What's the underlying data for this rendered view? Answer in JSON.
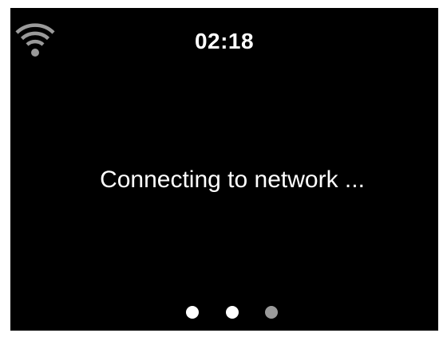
{
  "status_bar": {
    "wifi_icon": "wifi-icon",
    "time": "02:18"
  },
  "main": {
    "message": "Connecting to network ..."
  },
  "progress": {
    "total_steps": 3,
    "active_steps": 2,
    "colors": {
      "active": "#ffffff",
      "inactive": "#9a9a9a"
    }
  },
  "theme": {
    "background": "#000000",
    "text": "#ffffff",
    "icon": "#9a9a9a"
  }
}
